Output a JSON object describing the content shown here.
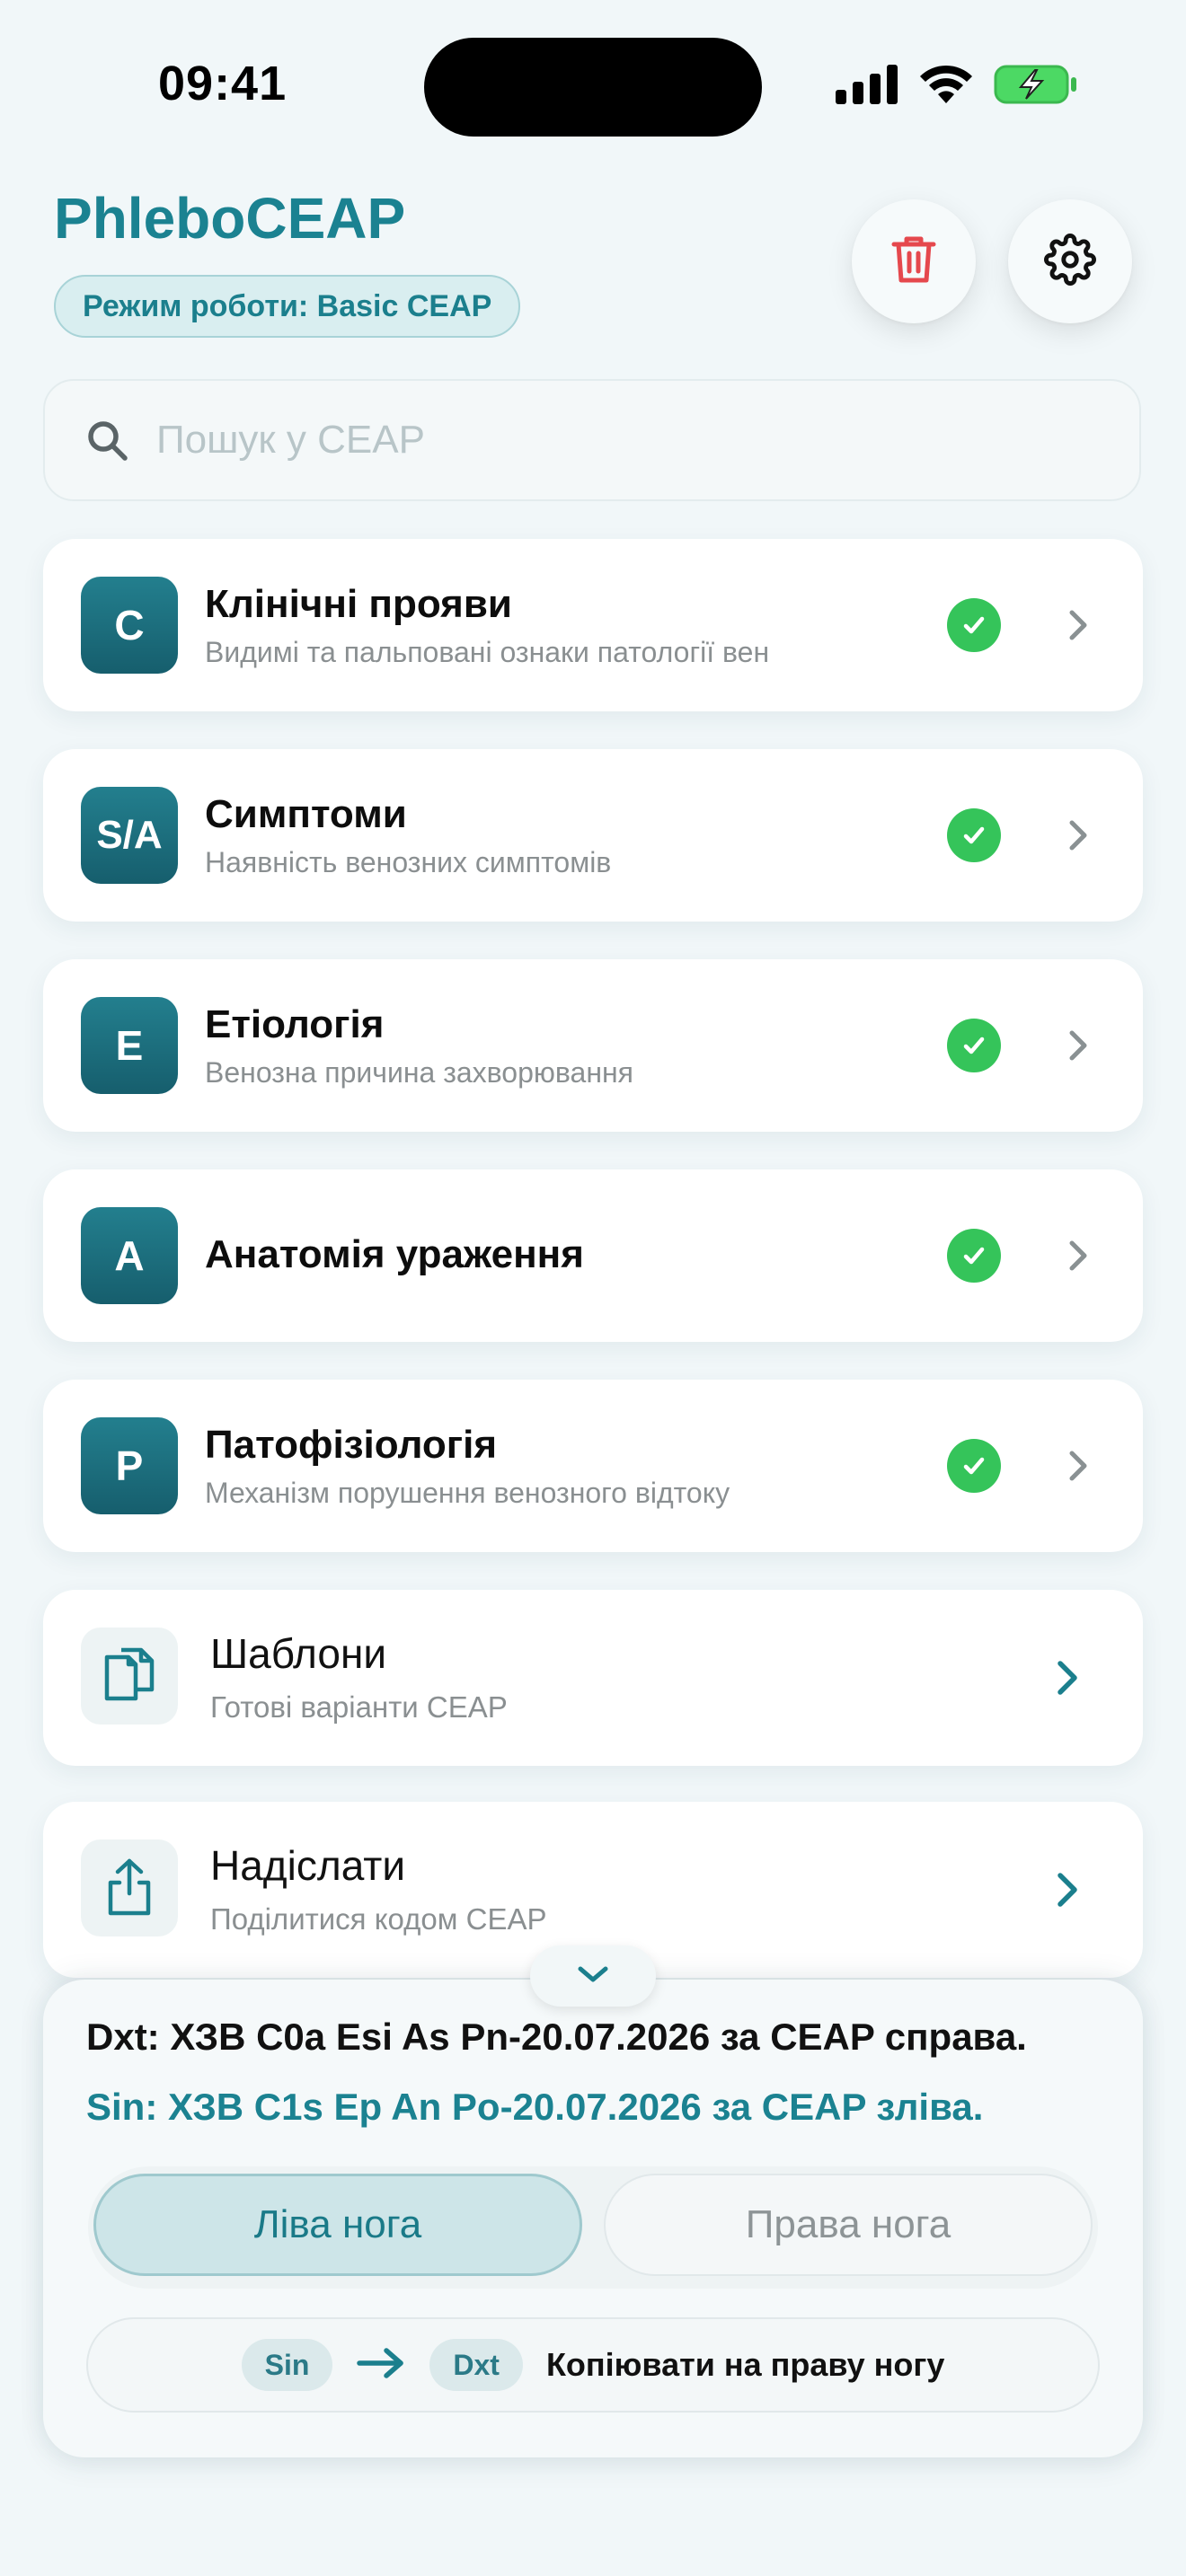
{
  "status_bar": {
    "time": "09:41",
    "icons": [
      "cellular-signal-icon",
      "wifi-icon",
      "battery-charging-icon"
    ]
  },
  "header": {
    "app_title": "PhleboCEAP",
    "mode_label": "Режим роботи: Basic CEAP",
    "actions": [
      "trash-icon",
      "gear-icon"
    ]
  },
  "search": {
    "placeholder": "Пошук у CEAP",
    "value": ""
  },
  "categories": [
    {
      "badge": "C",
      "title": "Клінічні прояви",
      "subtitle": "Видимі та пальповані ознаки патології вен",
      "completed": true
    },
    {
      "badge": "S/A",
      "title": "Симптоми",
      "subtitle": "Наявність венозних симптомів",
      "completed": true
    },
    {
      "badge": "E",
      "title": "Етіологія",
      "subtitle": "Венозна причина захворювання",
      "completed": true
    },
    {
      "badge": "A",
      "title": "Анатомія ураження",
      "subtitle": "",
      "completed": true
    },
    {
      "badge": "P",
      "title": "Патофізіологія",
      "subtitle": "Механізм порушення венозного відтоку",
      "completed": true
    }
  ],
  "actions": [
    {
      "icon": "copy-documents-icon",
      "title": "Шаблони",
      "subtitle": "Готові варіанти CEAP"
    },
    {
      "icon": "share-icon",
      "title": "Надіслати",
      "subtitle": "Поділитися кодом CEAP"
    }
  ],
  "summary": {
    "dxt_line": "Dxt: ХЗВ C0a Esi As Pn-20.07.2026 за CEAP справа.",
    "sin_line": "Sin: ХЗВ C1s Ep An Po-20.07.2026 за CEAP зліва.",
    "leg_selector": {
      "left_label": "Ліва нога",
      "right_label": "Права нога",
      "selected": "left"
    },
    "copy": {
      "from_chip": "Sin",
      "to_chip": "Dxt",
      "label": "Копіювати на праву ногу"
    }
  },
  "colors": {
    "accent": "#1b8291",
    "badge": "#1a6a79",
    "check": "#35c45a",
    "trash": "#e5484d",
    "background": "#f1f7f9"
  }
}
